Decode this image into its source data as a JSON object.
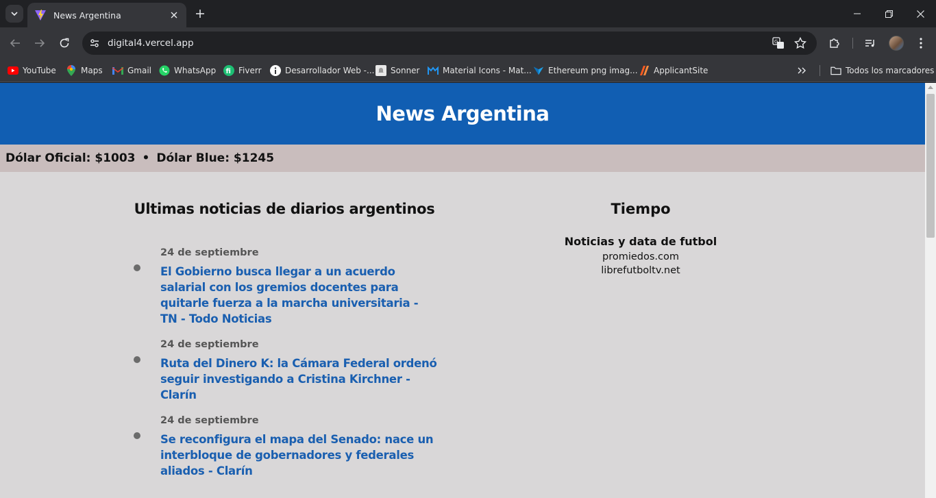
{
  "browser": {
    "tab_title": "News Argentina",
    "url": "digital4.vercel.app",
    "bookmarks": [
      {
        "label": "YouTube",
        "icon": "youtube-icon",
        "color": "#ff0000"
      },
      {
        "label": "Maps",
        "icon": "maps-icon",
        "color": "#34a853"
      },
      {
        "label": "Gmail",
        "icon": "gmail-icon",
        "color": "#ea4335"
      },
      {
        "label": "WhatsApp",
        "icon": "whatsapp-icon",
        "color": "#25d366"
      },
      {
        "label": "Fiverr",
        "icon": "fiverr-icon",
        "color": "#1dbf73"
      },
      {
        "label": "Desarrollador Web -...",
        "icon": "info-icon",
        "color": "#ffffff"
      },
      {
        "label": "Sonner",
        "icon": "sonner-icon",
        "color": "#e8e8e8"
      },
      {
        "label": "Material Icons - Mat...",
        "icon": "material-icons-icon",
        "color": "#2196f3"
      },
      {
        "label": "Ethereum png imag...",
        "icon": "ethereum-icon",
        "color": "#1ea0e8"
      },
      {
        "label": "ApplicantSite",
        "icon": "applicantsite-icon",
        "color": "#ff5a1f"
      }
    ],
    "all_bookmarks_label": "Todos los marcadores"
  },
  "site": {
    "title": "News Argentina",
    "dolar_oficial": "Dólar Oficial: $1003",
    "separator": "•",
    "dolar_blue": "Dólar Blue: $1245"
  },
  "news": {
    "heading": "Ultimas noticias de diarios argentinos",
    "items": [
      {
        "date": "24 de septiembre",
        "headline": "El Gobierno busca llegar a un acuerdo salarial con los gremios docentes para quitarle fuerza a la marcha universitaria - TN - Todo Noticias"
      },
      {
        "date": "24 de septiembre",
        "headline": "Ruta del Dinero K: la Cámara Federal ordenó seguir investigando a Cristina Kirchner - Clarín"
      },
      {
        "date": "24 de septiembre",
        "headline": "Se reconfigura el mapa del Senado: nace un interbloque de gobernadores y federales aliados - Clarín"
      }
    ]
  },
  "sidebar": {
    "heading": "Tiempo",
    "football_heading": "Noticias y data de futbol",
    "links": [
      "promiedos.com",
      "librefutboltv.net"
    ]
  },
  "colors": {
    "header_bg": "#115eb2",
    "headline_link": "#1a5fb0",
    "page_bg": "#d9d7d8",
    "dollar_bar_bg": "#c9bdbd"
  }
}
